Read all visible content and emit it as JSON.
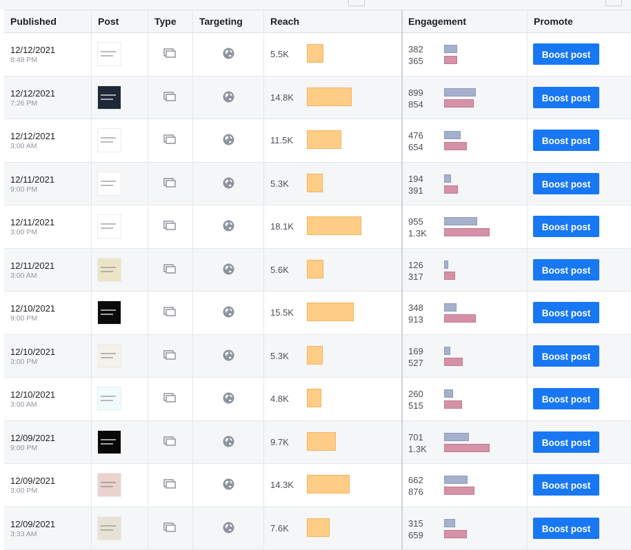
{
  "headers": {
    "published": "Published",
    "post": "Post",
    "type": "Type",
    "targeting": "Targeting",
    "reach": "Reach",
    "engagement": "Engagement",
    "promote": "Promote"
  },
  "boost_label": "Boost post",
  "icons": {
    "type": "multi-photo-icon",
    "targeting": "globe-icon"
  },
  "colors": {
    "reach_bar": "#ffcd86",
    "engagement_bar_1": "#a5b1cc",
    "engagement_bar_2": "#d592a7",
    "boost_button": "#1877f2"
  },
  "posts": [
    {
      "date": "12/12/2021",
      "time": "8:48 PM",
      "reach": "5.5K",
      "reach_value": 5.5,
      "eng1": "382",
      "eng1_value": 382,
      "eng2": "365",
      "eng2_value": 365,
      "thumb": "#ffffff"
    },
    {
      "date": "12/12/2021",
      "time": "7:26 PM",
      "reach": "14.8K",
      "reach_value": 14.8,
      "eng1": "899",
      "eng1_value": 899,
      "eng2": "854",
      "eng2_value": 854,
      "thumb": "#1f2937"
    },
    {
      "date": "12/12/2021",
      "time": "3:00 AM",
      "reach": "11.5K",
      "reach_value": 11.5,
      "eng1": "476",
      "eng1_value": 476,
      "eng2": "654",
      "eng2_value": 654,
      "thumb": "#ffffff"
    },
    {
      "date": "12/11/2021",
      "time": "9:00 PM",
      "reach": "5.3K",
      "reach_value": 5.3,
      "eng1": "194",
      "eng1_value": 194,
      "eng2": "391",
      "eng2_value": 391,
      "thumb": "#ffffff"
    },
    {
      "date": "12/11/2021",
      "time": "3:00 PM",
      "reach": "18.1K",
      "reach_value": 18.1,
      "eng1": "955",
      "eng1_value": 955,
      "eng2": "1.3K",
      "eng2_value": 1300,
      "thumb": "#ffffff"
    },
    {
      "date": "12/11/2021",
      "time": "3:00 AM",
      "reach": "5.6K",
      "reach_value": 5.6,
      "eng1": "126",
      "eng1_value": 126,
      "eng2": "317",
      "eng2_value": 317,
      "thumb": "#ece4c6"
    },
    {
      "date": "12/10/2021",
      "time": "9:00 PM",
      "reach": "15.5K",
      "reach_value": 15.5,
      "eng1": "348",
      "eng1_value": 348,
      "eng2": "913",
      "eng2_value": 913,
      "thumb": "#0b0b0b"
    },
    {
      "date": "12/10/2021",
      "time": "3:00 PM",
      "reach": "5.3K",
      "reach_value": 5.3,
      "eng1": "169",
      "eng1_value": 169,
      "eng2": "527",
      "eng2_value": 527,
      "thumb": "#f4f1ea"
    },
    {
      "date": "12/10/2021",
      "time": "3:00 AM",
      "reach": "4.8K",
      "reach_value": 4.8,
      "eng1": "260",
      "eng1_value": 260,
      "eng2": "515",
      "eng2_value": 515,
      "thumb": "#f0fbfb"
    },
    {
      "date": "12/09/2021",
      "time": "9:00 PM",
      "reach": "9.7K",
      "reach_value": 9.7,
      "eng1": "701",
      "eng1_value": 701,
      "eng2": "1.3K",
      "eng2_value": 1300,
      "thumb": "#080808"
    },
    {
      "date": "12/09/2021",
      "time": "3:00 PM",
      "reach": "14.3K",
      "reach_value": 14.3,
      "eng1": "662",
      "eng1_value": 662,
      "eng2": "876",
      "eng2_value": 876,
      "thumb": "#ead3cf"
    },
    {
      "date": "12/09/2021",
      "time": "3:33 AM",
      "reach": "7.6K",
      "reach_value": 7.6,
      "eng1": "315",
      "eng1_value": 315,
      "eng2": "659",
      "eng2_value": 659,
      "thumb": "#e8e2d6"
    }
  ]
}
